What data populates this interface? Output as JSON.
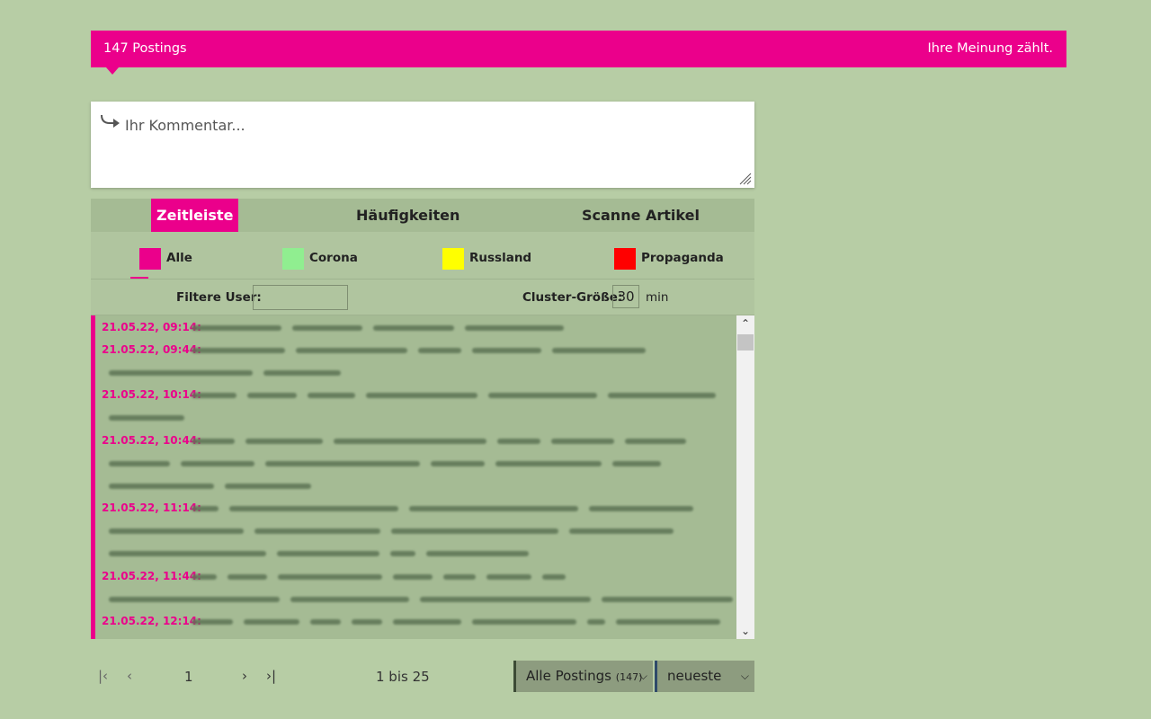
{
  "header": {
    "count_label": "147 Postings",
    "slogan": "Ihre Meinung zählt."
  },
  "comment": {
    "placeholder": "Ihr Kommentar..."
  },
  "tabs": [
    {
      "label": "Zeitleiste",
      "active": true
    },
    {
      "label": "Häufigkeiten",
      "active": false
    },
    {
      "label": "Scanne Artikel",
      "active": false
    }
  ],
  "categories": [
    {
      "label": "Alle",
      "color": "#eb008b",
      "active": true
    },
    {
      "label": "Corona",
      "color": "#90ee90",
      "active": false
    },
    {
      "label": "Russland",
      "color": "#ffff00",
      "active": false
    },
    {
      "label": "Propaganda",
      "color": "#ff0000",
      "active": false
    }
  ],
  "filters": {
    "user_label": "Filtere User:",
    "user_value": "",
    "cluster_label": "Cluster-Größe:",
    "cluster_value": "30",
    "unit": "min"
  },
  "timeline": [
    {
      "time": "21.05.22, 09:14:"
    },
    {
      "time": "21.05.22, 09:44:"
    },
    {
      "time": "21.05.22, 10:14:"
    },
    {
      "time": "21.05.22, 10:44:"
    },
    {
      "time": "21.05.22, 11:14:"
    },
    {
      "time": "21.05.22, 11:44:"
    },
    {
      "time": "21.05.22, 12:14:"
    }
  ],
  "pager": {
    "page": "1",
    "range": "1 bis 25",
    "filter_select": "Alle Postings",
    "filter_count": "(147)",
    "sort_select": "neueste"
  },
  "colors": {
    "accent": "#eb008b",
    "background": "#b7cda5"
  }
}
